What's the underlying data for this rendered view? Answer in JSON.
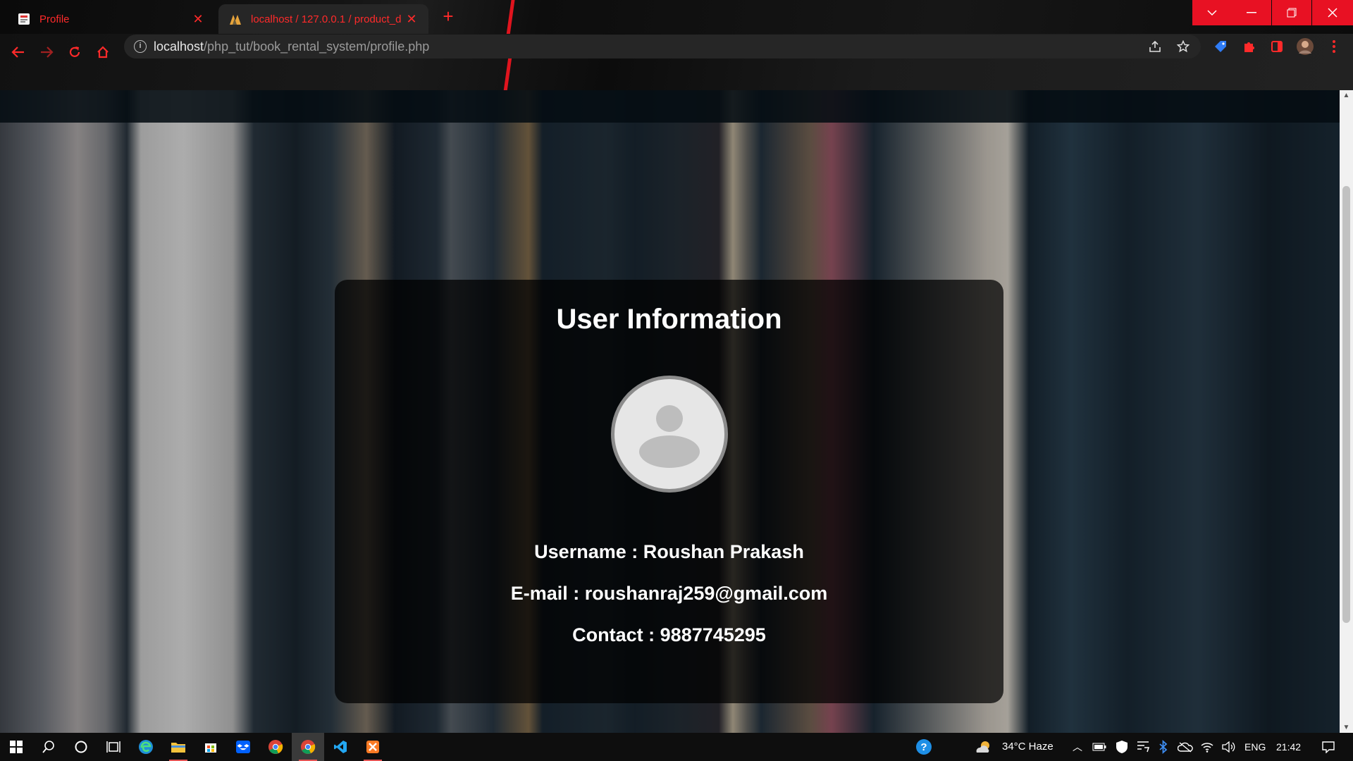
{
  "browser": {
    "tabs": [
      {
        "title": "Profile",
        "active": false
      },
      {
        "title": "localhost / 127.0.0.1 / product_d",
        "active": true
      }
    ],
    "new_tab_symbol": "+",
    "close_symbol": "✕",
    "url_host": "localhost",
    "url_path": "/php_tut/book_rental_system/profile.php",
    "accent_color": "#ff2a2a"
  },
  "profile": {
    "heading": "User Information",
    "username_label": "Username : ",
    "username": "Roushan Prakash",
    "email_label": "E-mail : ",
    "email": "roushanraj259@gmail.com",
    "contact_label": "Contact : ",
    "contact": "9887745295"
  },
  "taskbar": {
    "weather": "34°C  Haze",
    "language": "ENG",
    "time": "21:42"
  }
}
